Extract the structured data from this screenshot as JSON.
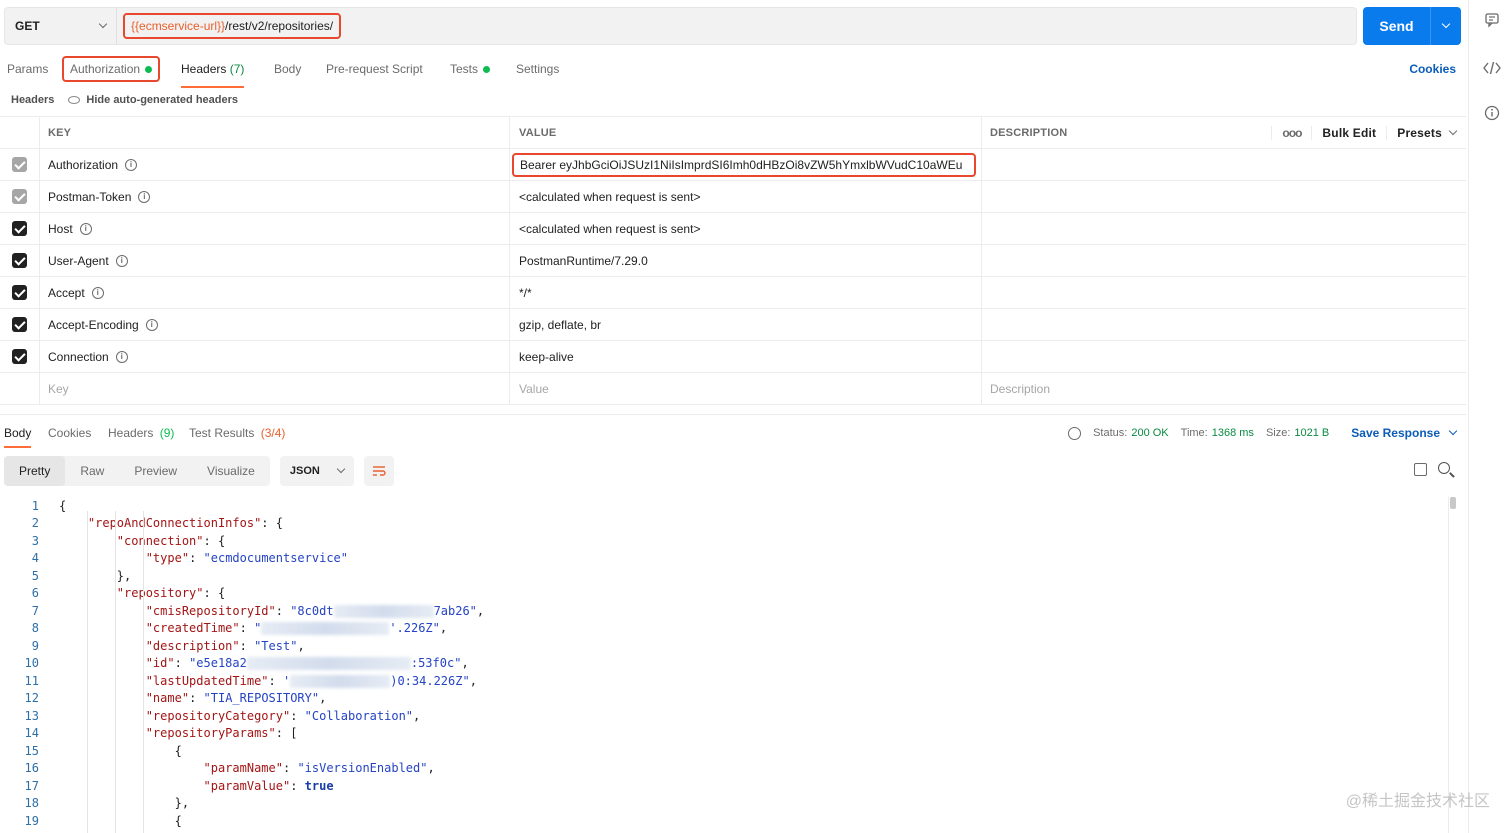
{
  "request": {
    "method": "GET",
    "url_var": "{{ecmservice-url}}",
    "url_path": "/rest/v2/repositories/",
    "send_label": "Send"
  },
  "req_tabs": {
    "params": "Params",
    "authorization": "Authorization",
    "headers": "Headers",
    "headers_count": "(7)",
    "body": "Body",
    "prerequest": "Pre-request Script",
    "tests": "Tests",
    "settings": "Settings",
    "cookies": "Cookies"
  },
  "headers_bar": {
    "title": "Headers",
    "hide_label": "Hide auto-generated headers"
  },
  "table": {
    "col_key": "KEY",
    "col_value": "VALUE",
    "col_description": "DESCRIPTION",
    "bulk_edit": "Bulk Edit",
    "presets": "Presets",
    "more": "ooo",
    "rows": [
      {
        "key": "Authorization",
        "value": "Bearer eyJhbGciOiJSUzI1NiIsImprdSI6Imh0dHBzOi8vZW5hYmxlbWVudC10aWEu"
      },
      {
        "key": "Postman-Token",
        "value": "<calculated when request is sent>"
      },
      {
        "key": "Host",
        "value": "<calculated when request is sent>"
      },
      {
        "key": "User-Agent",
        "value": "PostmanRuntime/7.29.0"
      },
      {
        "key": "Accept",
        "value": "*/*"
      },
      {
        "key": "Accept-Encoding",
        "value": "gzip, deflate, br"
      },
      {
        "key": "Connection",
        "value": "keep-alive"
      }
    ],
    "ph_key": "Key",
    "ph_value": "Value",
    "ph_description": "Description"
  },
  "response": {
    "tabs": {
      "body": "Body",
      "cookies": "Cookies",
      "headers": "Headers",
      "headers_count": "(9)",
      "tests": "Test Results",
      "tests_count": "(3/4)"
    },
    "status_label": "Status:",
    "status_value": "200 OK",
    "time_label": "Time:",
    "time_value": "1368 ms",
    "size_label": "Size:",
    "size_value": "1021 B",
    "save": "Save Response",
    "views": [
      "Pretty",
      "Raw",
      "Preview",
      "Visualize"
    ],
    "format": "JSON"
  },
  "code": {
    "line_numbers": [
      "1",
      "2",
      "3",
      "4",
      "5",
      "6",
      "7",
      "8",
      "9",
      "10",
      "11",
      "12",
      "13",
      "14",
      "15",
      "16",
      "17",
      "18",
      "19"
    ],
    "l1": "{",
    "k_repo": "\"repoAndConnectionInfos\"",
    "k_connection": "\"connection\"",
    "k_type": "\"type\"",
    "v_type": "\"ecmdocumentservice\"",
    "k_repository": "\"repository\"",
    "k_cmis": "\"cmisRepositoryId\"",
    "v_cmis_a": "\"8c0dt",
    "v_cmis_b": "7ab26\"",
    "k_created": "\"createdTime\"",
    "v_created_a": "\"",
    "v_created_b": "'.226Z\"",
    "k_desc": "\"description\"",
    "v_desc": "\"Test\"",
    "k_id": "\"id\"",
    "v_id_a": "\"e5e18a2",
    "v_id_b": ":53f0c\"",
    "k_updated": "\"lastUpdatedTime\"",
    "v_updated_a": "'",
    "v_updated_b": ")0:34.226Z\"",
    "k_name": "\"name\"",
    "v_name": "\"TIA_REPOSITORY\"",
    "k_category": "\"repositoryCategory\"",
    "v_category": "\"Collaboration\"",
    "k_params": "\"repositoryParams\"",
    "k_pname": "\"paramName\"",
    "v_pname": "\"isVersionEnabled\"",
    "k_pvalue": "\"paramValue\"",
    "v_pvalue": "true"
  },
  "watermark": "@稀土掘金技术社区"
}
